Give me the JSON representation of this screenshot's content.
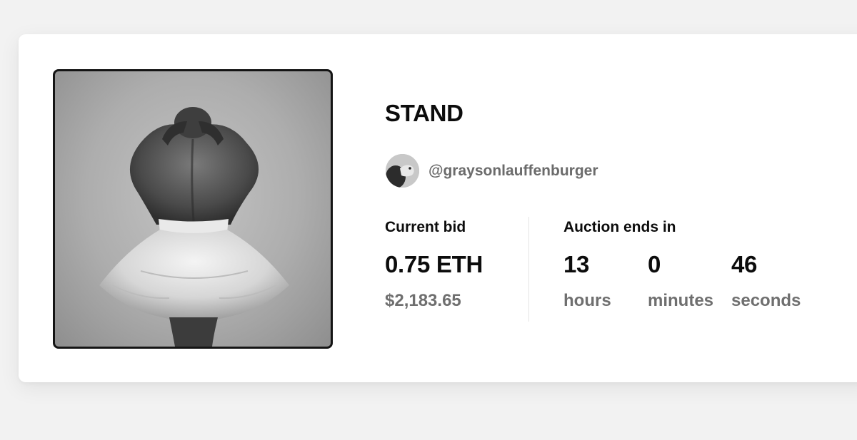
{
  "artwork": {
    "title": "STAND"
  },
  "creator": {
    "username": "@graysonlauffenburger"
  },
  "bid": {
    "label": "Current bid",
    "amount": "0.75 ETH",
    "usd": "$2,183.65"
  },
  "auction": {
    "label": "Auction ends in",
    "hours_value": "13",
    "hours_label": "hours",
    "minutes_value": "0",
    "minutes_label": "minutes",
    "seconds_value": "46",
    "seconds_label": "seconds"
  }
}
